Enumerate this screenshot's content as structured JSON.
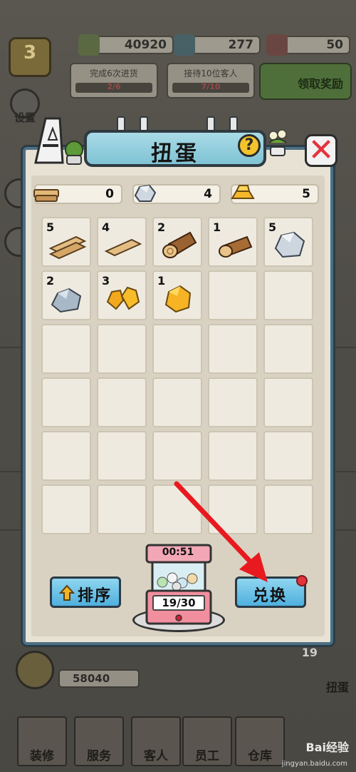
{
  "hud": {
    "level": "3",
    "cash": "40920",
    "gems": "277",
    "roses": "50",
    "tasks": [
      {
        "label": "完成6次进货",
        "progress": "2/6"
      },
      {
        "label": "接待10位客人",
        "progress": "7/10"
      }
    ],
    "reward_button": "领取奖励",
    "settings_label": "设置",
    "money_bottom": "58040",
    "gacha_badge": "19",
    "gacha_label": "扭蛋"
  },
  "bottom_tabs": [
    "装修",
    "服务",
    "客人",
    "员工",
    "仓库"
  ],
  "modal": {
    "title": "扭蛋",
    "help_symbol": "?",
    "close_symbol": "✕",
    "summary": [
      {
        "item": "wood",
        "count": "0"
      },
      {
        "item": "stone",
        "count": "4"
      },
      {
        "item": "gold",
        "count": "5"
      }
    ],
    "inventory": [
      {
        "item": "plank",
        "count": "5"
      },
      {
        "item": "plank",
        "count": "4"
      },
      {
        "item": "log",
        "count": "2"
      },
      {
        "item": "log",
        "count": "1"
      },
      {
        "item": "stone",
        "count": "5"
      },
      {
        "item": "stone",
        "count": "2"
      },
      {
        "item": "gold-ore",
        "count": "3"
      },
      {
        "item": "gold-ore",
        "count": "1"
      }
    ],
    "sort_button": "排序",
    "exchange_button": "兑换",
    "machine_timer": "00:51",
    "machine_count": "19/30"
  },
  "watermark": {
    "brand": "Bai经验",
    "url": "jingyan.baidu.com"
  },
  "colors": {
    "panel_border": "#4c6f84",
    "button": "#4fb0de",
    "arrow": "#e8191f",
    "close": "#e5333d"
  }
}
